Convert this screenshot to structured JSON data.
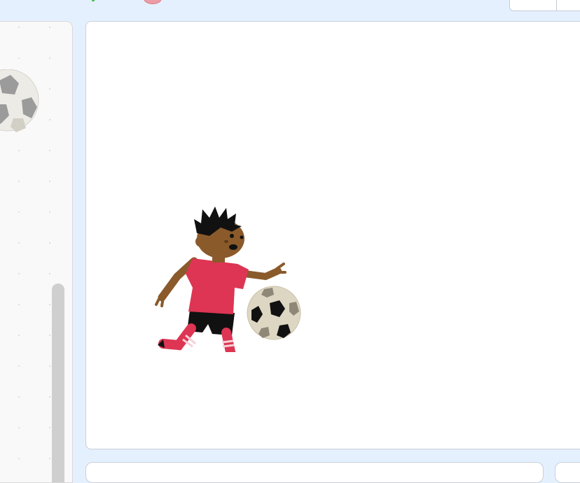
{
  "toolbar": {
    "green_flag_icon": "green-flag-icon",
    "stop_icon": "stop-icon",
    "stage_size_toggle": "stage-size-toggle"
  },
  "code_area": {
    "thumbnail_icon": "soccer-ball-icon"
  },
  "stage": {
    "sprites": [
      {
        "name": "player-kicking-sprite",
        "icon": "soccer-player-icon"
      },
      {
        "name": "soccer-ball-sprite",
        "icon": "soccer-ball-icon"
      }
    ]
  },
  "colors": {
    "background": "#e5f0ff",
    "stage": "#ffffff",
    "jersey": "#dd3553",
    "skin": "#8a5a2b",
    "green_flag": "#4cbf56"
  }
}
